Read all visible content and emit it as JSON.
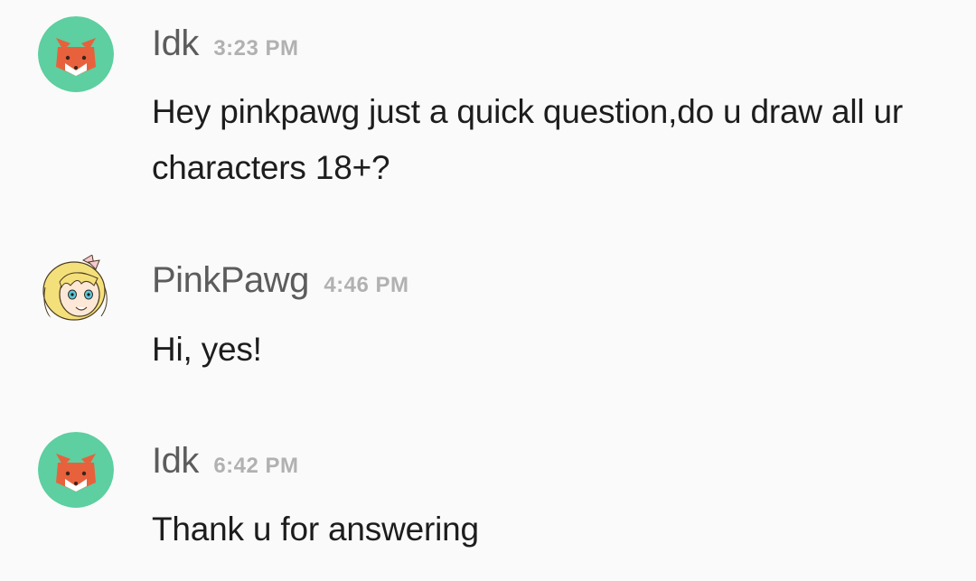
{
  "messages": [
    {
      "username": "Idk",
      "timestamp": "3:23 PM",
      "text": "Hey pinkpawg just a quick question,do u draw all ur characters 18+?",
      "avatar_icon": "fox-face-icon"
    },
    {
      "username": "PinkPawg",
      "timestamp": "4:46 PM",
      "text": "Hi, yes!",
      "avatar_icon": "blonde-anime-girl-icon"
    },
    {
      "username": "Idk",
      "timestamp": "6:42 PM",
      "text": "Thank u for answering",
      "avatar_icon": "fox-face-icon"
    }
  ],
  "colors": {
    "background": "#fafafa",
    "username": "#5c5c5c",
    "timestamp": "#b1b1b1",
    "message_text": "#1d1d1d",
    "fox_avatar_bg": "#5dcfa0",
    "fox_orange": "#e8613d"
  }
}
